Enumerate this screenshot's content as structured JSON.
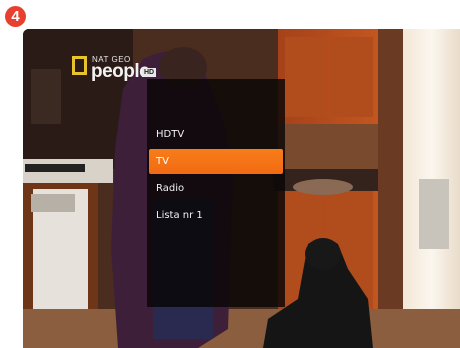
{
  "step_badge": {
    "number": "4",
    "color": "#e8402f"
  },
  "channel_logo": {
    "top_text": "NAT GEO",
    "main_text": "people",
    "hd_text": "HD",
    "icon": "nat-geo-yellow-frame"
  },
  "menu": {
    "selected_color": "#f26a12",
    "items": [
      {
        "label": "HDTV",
        "selected": false
      },
      {
        "label": "TV",
        "selected": true
      },
      {
        "label": "Radio",
        "selected": false
      },
      {
        "label": "Lista nr 1",
        "selected": false
      }
    ]
  }
}
